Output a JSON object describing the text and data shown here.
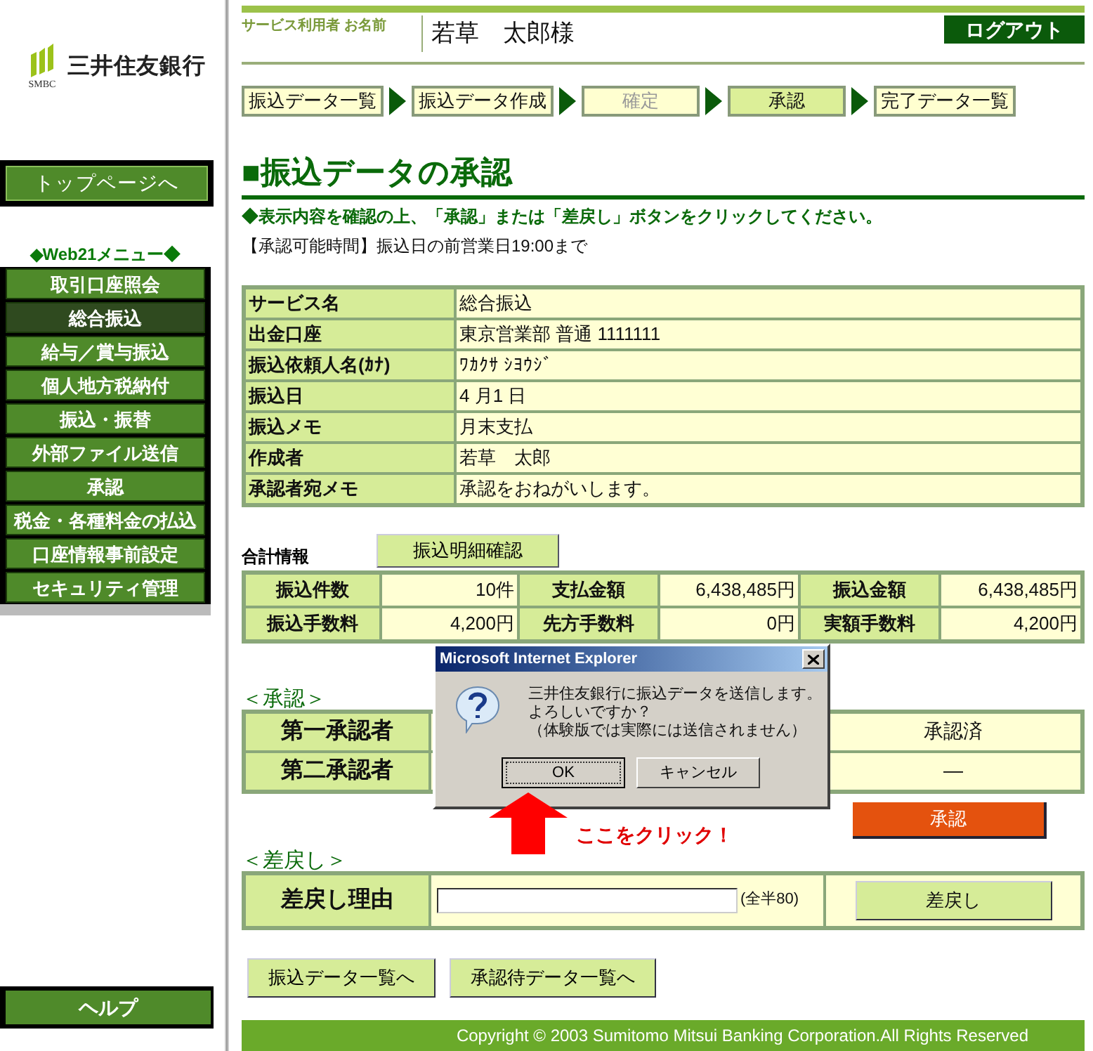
{
  "sidebar": {
    "bank_name": "三井住友銀行",
    "logo_caption": "SMBC",
    "top_button": "トップページへ",
    "menu_title": "◆Web21メニュー◆",
    "items": [
      {
        "label": "取引口座照会",
        "selected": false
      },
      {
        "label": "総合振込",
        "selected": true
      },
      {
        "label": "給与／賞与振込",
        "selected": false
      },
      {
        "label": "個人地方税納付",
        "selected": false
      },
      {
        "label": "振込・振替",
        "selected": false
      },
      {
        "label": "外部ファイル送信",
        "selected": false
      },
      {
        "label": "承認",
        "selected": false
      },
      {
        "label": "税金・各種料金の払込",
        "selected": false
      },
      {
        "label": "口座情報事前設定",
        "selected": false
      },
      {
        "label": "セキュリティ管理",
        "selected": false
      }
    ],
    "help_button": "ヘルプ"
  },
  "header": {
    "user_label": "サービス利用者 お名前",
    "user_name": "若草　太郎様",
    "logout": "ログアウト"
  },
  "steps": [
    {
      "label": "振込データ一覧",
      "selected": false,
      "disabled": false
    },
    {
      "label": "振込データ作成",
      "selected": false,
      "disabled": false
    },
    {
      "label": "確定",
      "selected": false,
      "disabled": true
    },
    {
      "label": "承認",
      "selected": true,
      "disabled": false
    },
    {
      "label": "完了データ一覧",
      "selected": false,
      "disabled": false
    }
  ],
  "title": "■振込データの承認",
  "instruction": "◆表示内容を確認の上、「承認」または「差戻し」ボタンをクリックしてください。",
  "time_note": "【承認可能時間】振込日の前営業日19:00まで",
  "info_table": [
    {
      "label": "サービス名",
      "value": "総合振込"
    },
    {
      "label": "出金口座",
      "value": "東京営業部 普通 1111111"
    },
    {
      "label": "振込依頼人名(ｶﾅ)",
      "value": "ﾜｶｸｻ ｼﾖｳｼﾞ"
    },
    {
      "label": "振込日",
      "value": "4 月1 日"
    },
    {
      "label": "振込メモ",
      "value": "月末支払"
    },
    {
      "label": "作成者",
      "value": "若草　太郎"
    },
    {
      "label": "承認者宛メモ",
      "value": "承認をおねがいします。"
    }
  ],
  "summary": {
    "label": "合計情報",
    "detail_button": "振込明細確認",
    "rows": [
      [
        {
          "label": "振込件数",
          "value": "10件"
        },
        {
          "label": "支払金額",
          "value": "6,438,485円"
        },
        {
          "label": "振込金額",
          "value": "6,438,485円"
        }
      ],
      [
        {
          "label": "振込手数料",
          "value": "4,200円"
        },
        {
          "label": "先方手数料",
          "value": "0円"
        },
        {
          "label": "実額手数料",
          "value": "4,200円"
        }
      ]
    ]
  },
  "approval": {
    "heading": "＜承認＞",
    "rows": [
      {
        "label": "第一承認者",
        "status": "承認済"
      },
      {
        "label": "第二承認者",
        "status": "—"
      }
    ],
    "button": "承認"
  },
  "sendback": {
    "heading": "＜差戻し＞",
    "label": "差戻し理由",
    "note": "(全半80)",
    "button": "差戻し"
  },
  "nav_buttons": [
    "振込データ一覧へ",
    "承認待データ一覧へ"
  ],
  "footer": "Copyright © 2003 Sumitomo Mitsui Banking Corporation.All Rights Reserved",
  "dialog": {
    "title": "Microsoft Internet Explorer",
    "lines": [
      "三井住友銀行に振込データを送信します。",
      "よろしいですか？",
      "（体験版では実際には送信されません）"
    ],
    "buttons": [
      {
        "label": "OK",
        "selected": true
      },
      {
        "label": "キャンセル",
        "selected": false
      }
    ]
  },
  "callout": "ここをクリック！"
}
